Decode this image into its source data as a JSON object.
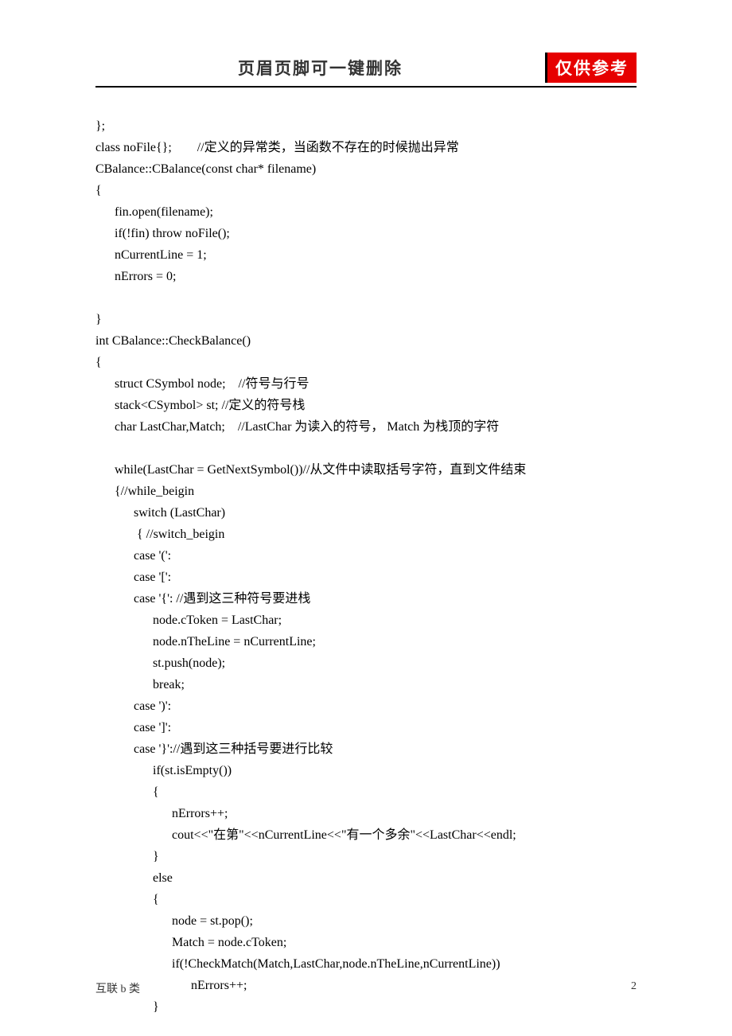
{
  "header": {
    "title": "页眉页脚可一键删除",
    "badge": "仅供参考"
  },
  "code": {
    "lines": [
      "};",
      "class noFile{};        //定义的异常类，当函数不存在的时候抛出异常",
      "CBalance::CBalance(const char* filename)",
      "{",
      "      fin.open(filename);",
      "      if(!fin) throw noFile();",
      "      nCurrentLine = 1;",
      "      nErrors = 0;",
      "",
      "}",
      "int CBalance::CheckBalance()",
      "{",
      "      struct CSymbol node;    //符号与行号",
      "      stack<CSymbol> st; //定义的符号栈",
      "      char LastChar,Match;    //LastChar 为读入的符号， Match 为栈顶的字符",
      "",
      "      while(LastChar = GetNextSymbol())//从文件中读取括号字符，直到文件结束",
      "      {//while_beigin",
      "            switch (LastChar)",
      "             { //switch_beigin",
      "            case '(':",
      "            case '[':",
      "            case '{': //遇到这三种符号要进栈",
      "                  node.cToken = LastChar;",
      "                  node.nTheLine = nCurrentLine;",
      "                  st.push(node);",
      "                  break;",
      "            case ')':",
      "            case ']':",
      "            case '}'://遇到这三种括号要进行比较",
      "                  if(st.isEmpty())",
      "                  {",
      "                        nErrors++;",
      "                        cout<<\"在第\"<<nCurrentLine<<\"有一个多余\"<<LastChar<<endl;",
      "                  }",
      "                  else",
      "                  {",
      "                        node = st.pop();",
      "                        Match = node.cToken;",
      "                        if(!CheckMatch(Match,LastChar,node.nTheLine,nCurrentLine))",
      "                              nErrors++;",
      "                  }"
    ]
  },
  "footer": {
    "left": "互联 b 类",
    "right": "2"
  }
}
